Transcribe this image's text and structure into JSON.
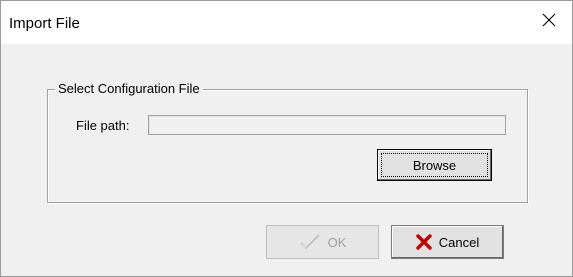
{
  "window": {
    "title": "Import File"
  },
  "group": {
    "legend": "Select Configuration File",
    "path_label": "File path:",
    "path_value": ""
  },
  "buttons": {
    "browse": "Browse",
    "ok": "OK",
    "cancel": "Cancel"
  },
  "icons": {
    "close": "close-icon",
    "ok": "checkmark-icon",
    "cancel": "red-x-icon"
  },
  "colors": {
    "cancel_icon": "#c00000",
    "disabled_text": "#a0a0a0"
  }
}
